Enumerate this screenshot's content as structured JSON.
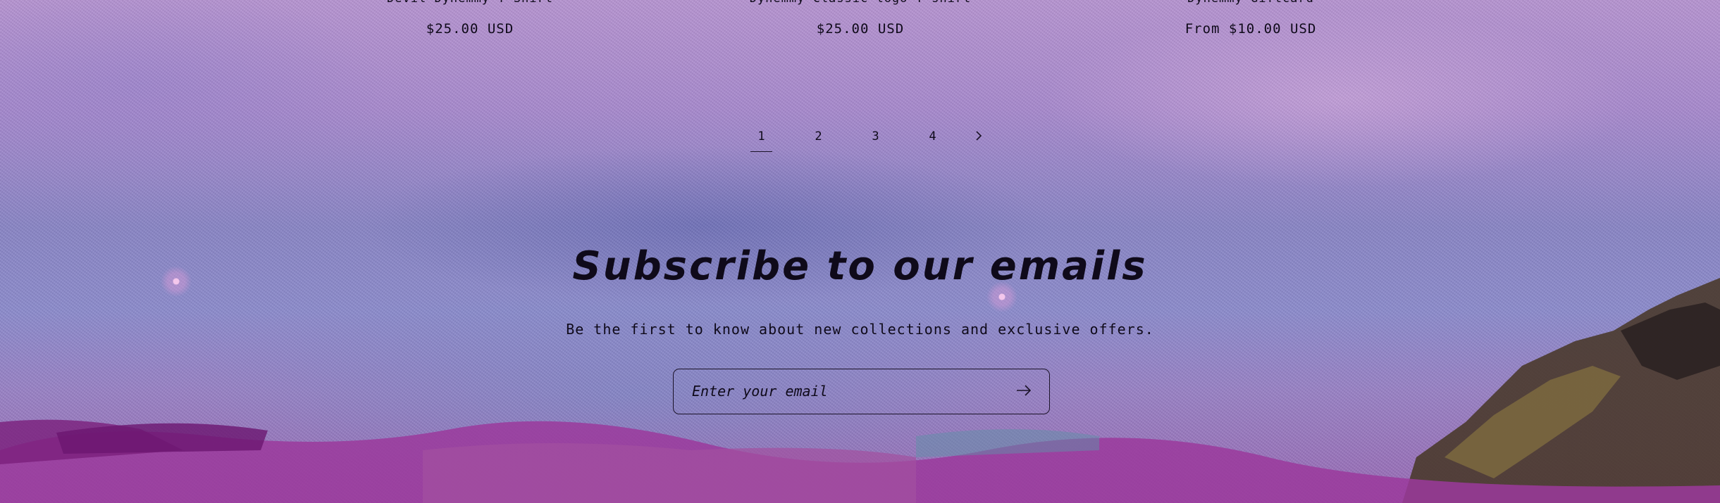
{
  "products": [
    {
      "title": "Devil Dynemmy T-Shirt",
      "price": "$25.00 USD"
    },
    {
      "title": "Dynemmy Classic logo T-shirt",
      "price": "$25.00 USD"
    },
    {
      "title": "Dynemmy Giftcard",
      "price": "From $10.00 USD"
    }
  ],
  "pagination": {
    "pages": [
      "1",
      "2",
      "3",
      "4"
    ],
    "current": "1",
    "next_icon": "chevron-right-icon"
  },
  "newsletter": {
    "heading": "Subscribe to our emails",
    "subtext": "Be the first to know about new collections and exclusive offers.",
    "email_placeholder": "Enter your email",
    "submit_icon": "arrow-right-icon"
  },
  "colors": {
    "text": "#0f0a1a",
    "background_top": "#b795d2",
    "background_mid": "#8a86c6",
    "flowers": "#9b3a9c"
  }
}
